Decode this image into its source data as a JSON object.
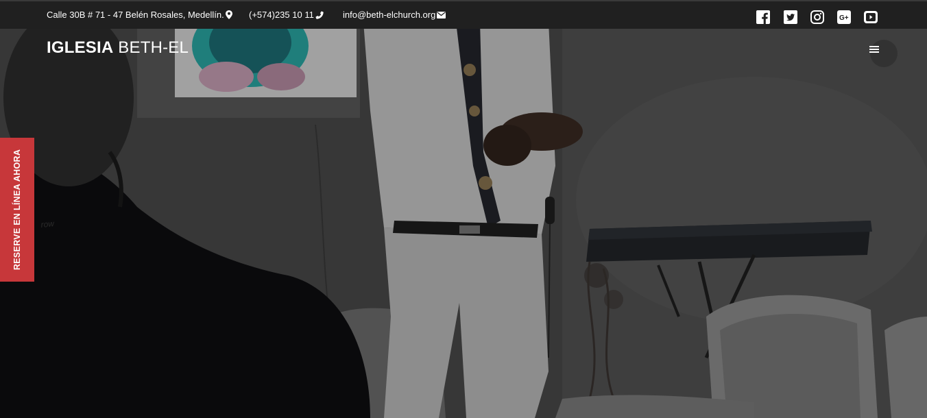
{
  "topbar": {
    "address": "Calle 30B # 71 - 47 Belén Rosales, Medellín.",
    "phone": "(+574)235 10 11",
    "email": "info@beth-elchurch.org",
    "icons": [
      "map-pin-icon",
      "phone-icon",
      "envelope-icon"
    ],
    "social": [
      "facebook-icon",
      "twitter-icon",
      "instagram-icon",
      "google-plus-icon",
      "youtube-icon"
    ]
  },
  "header": {
    "brand_bold": "IGLESIA",
    "brand_light": "BETH-EL",
    "menu_icon": "hamburger-menu-icon"
  },
  "sidebar_tab": {
    "label": "RESERVE EN LÍNEA AHORA",
    "color": "#c7373a"
  },
  "colors": {
    "topbar_bg": "#202020",
    "text": "#ffffff"
  }
}
